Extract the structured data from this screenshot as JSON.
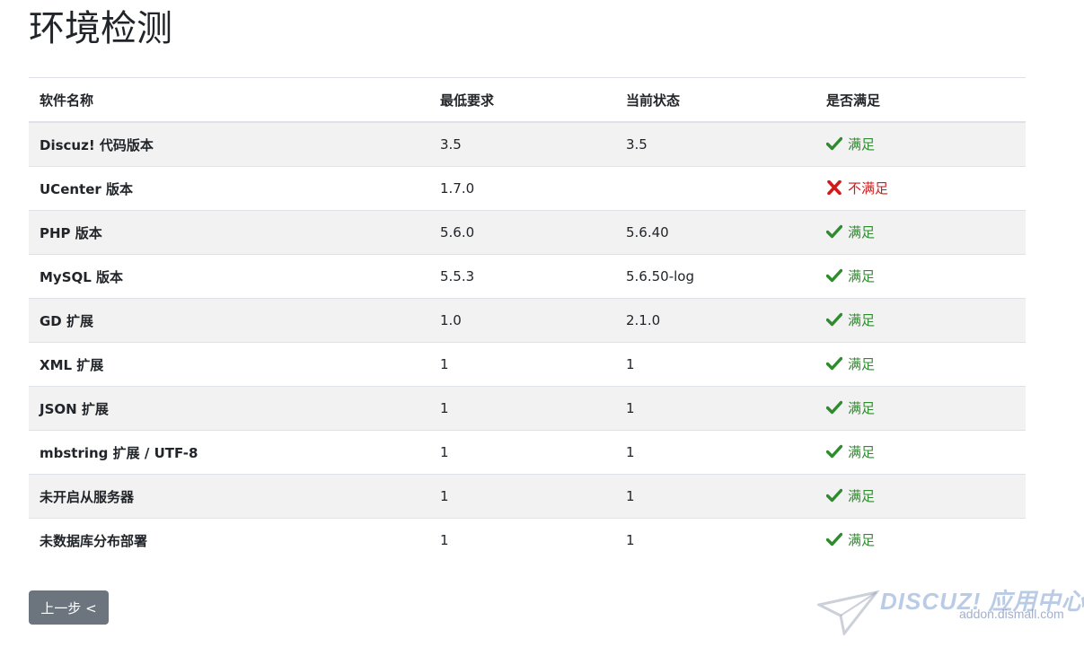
{
  "page": {
    "title": "环境检测"
  },
  "table": {
    "headers": [
      "软件名称",
      "最低要求",
      "当前状态",
      "是否满足"
    ],
    "rows": [
      {
        "name": "Discuz! 代码版本",
        "min": "3.5",
        "current": "3.5",
        "status": "满足",
        "ok": true
      },
      {
        "name": "UCenter 版本",
        "min": "1.7.0",
        "current": "",
        "status": "不满足",
        "ok": false
      },
      {
        "name": "PHP 版本",
        "min": "5.6.0",
        "current": "5.6.40",
        "status": "满足",
        "ok": true
      },
      {
        "name": "MySQL 版本",
        "min": "5.5.3",
        "current": "5.6.50-log",
        "status": "满足",
        "ok": true
      },
      {
        "name": "GD 扩展",
        "min": "1.0",
        "current": "2.1.0",
        "status": "满足",
        "ok": true
      },
      {
        "name": "XML 扩展",
        "min": "1",
        "current": "1",
        "status": "满足",
        "ok": true
      },
      {
        "name": "JSON 扩展",
        "min": "1",
        "current": "1",
        "status": "满足",
        "ok": true
      },
      {
        "name": "mbstring 扩展 / UTF-8",
        "min": "1",
        "current": "1",
        "status": "满足",
        "ok": true
      },
      {
        "name": "未开启从服务器",
        "min": "1",
        "current": "1",
        "status": "满足",
        "ok": true
      },
      {
        "name": "未数据库分布部署",
        "min": "1",
        "current": "1",
        "status": "满足",
        "ok": true
      }
    ]
  },
  "actions": {
    "back_label": "上一步 <"
  },
  "watermark": {
    "line1": "DISCUZ! 应用中心",
    "line2": "addon.dismall.com"
  },
  "colors": {
    "ok": "#2e8b2e",
    "fail": "#d11a1a",
    "stripe": "#f2f2f2",
    "button": "#6c757d"
  },
  "icons": {
    "ok": "check-icon",
    "fail": "cross-icon"
  }
}
